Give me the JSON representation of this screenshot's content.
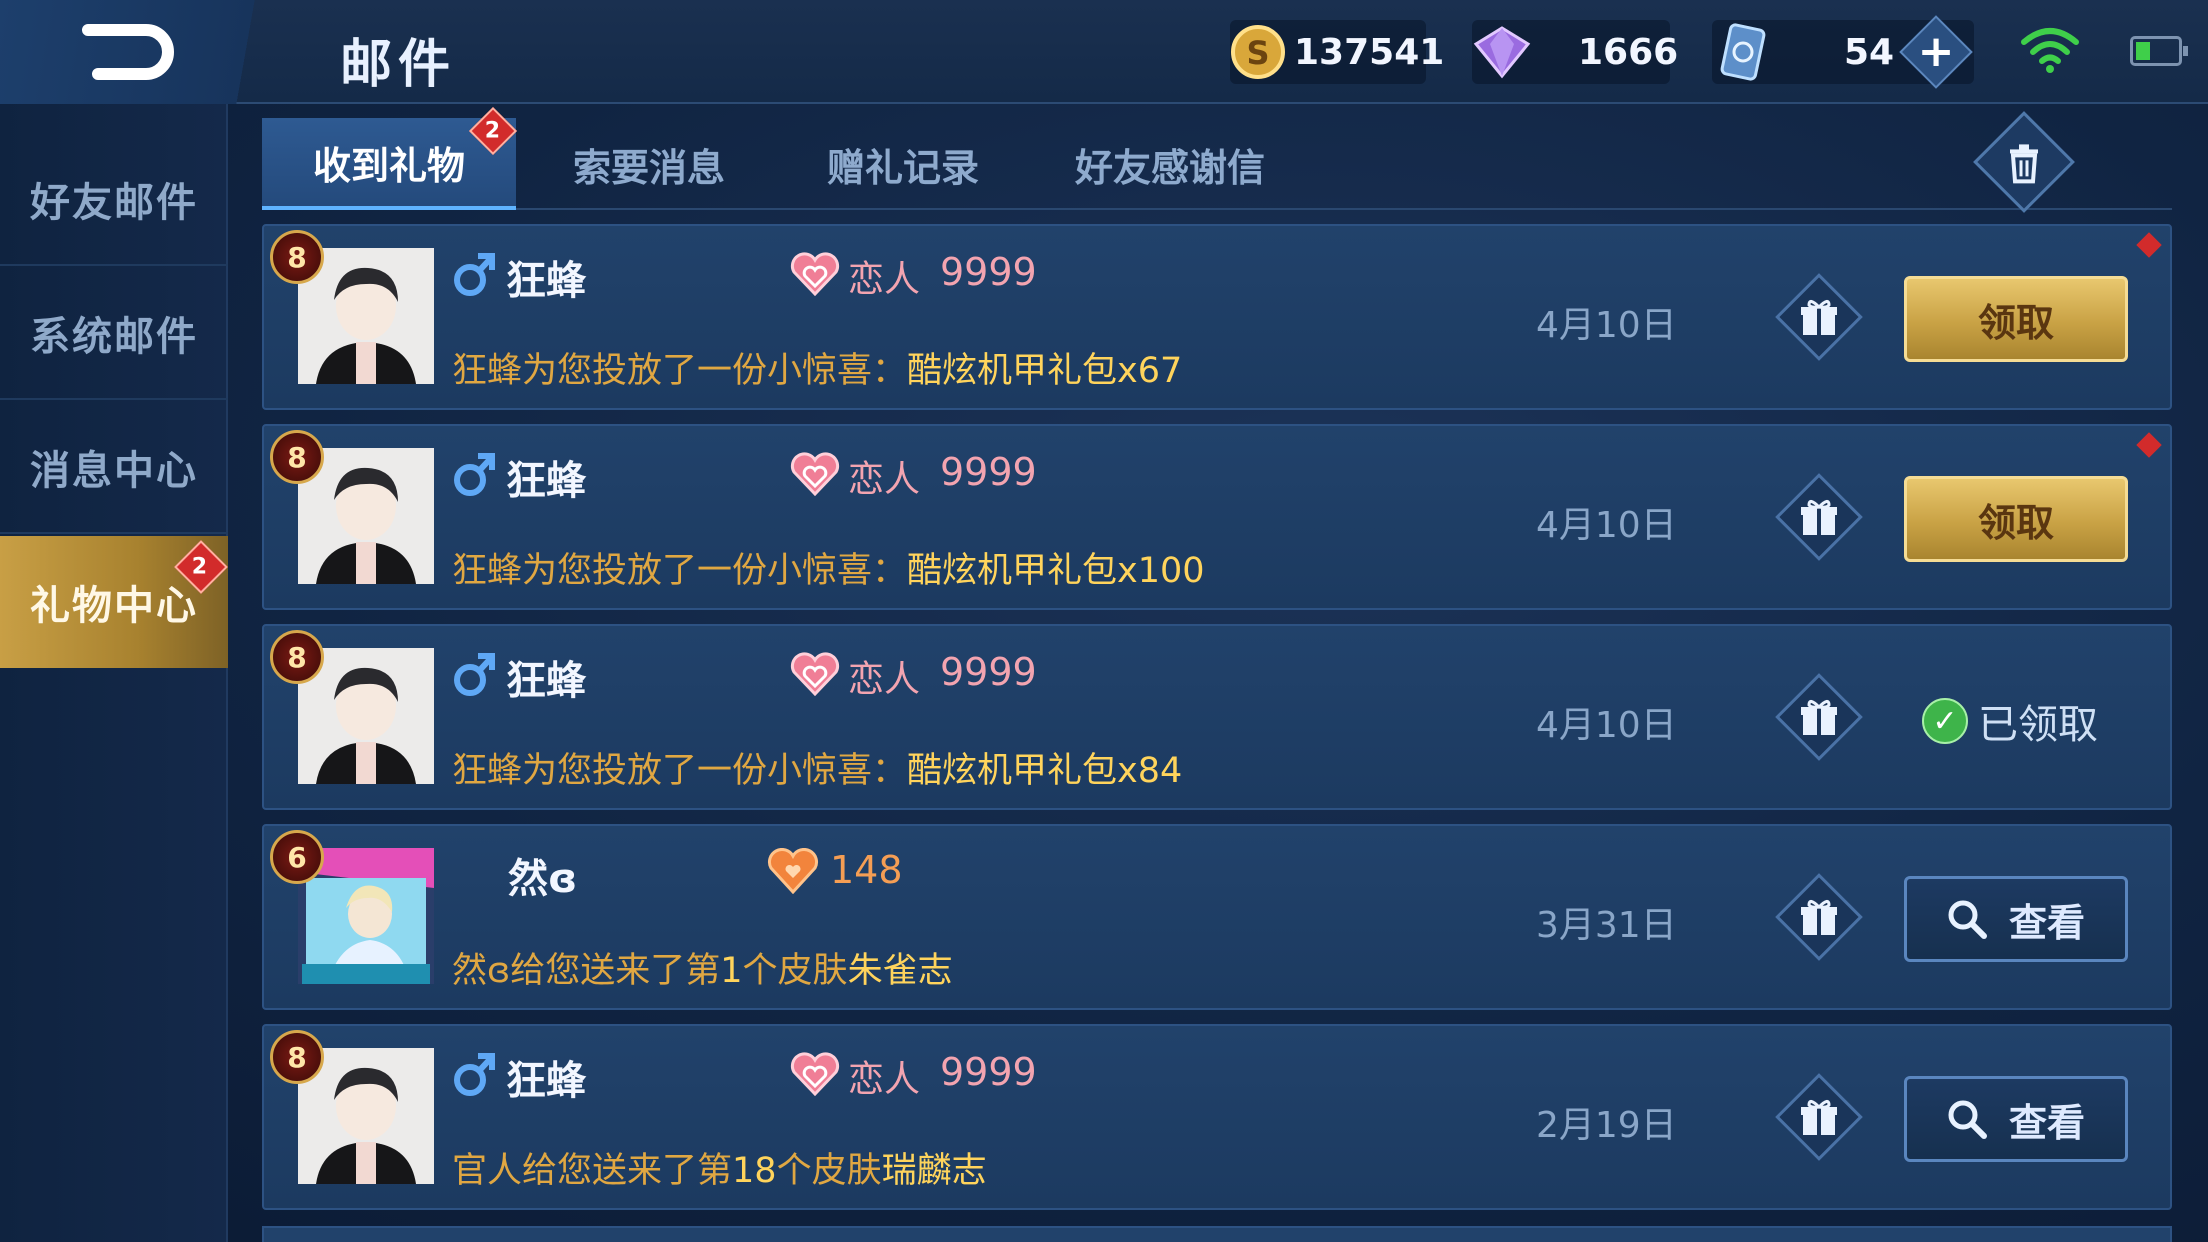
{
  "header": {
    "title": "邮件",
    "coins": "137541",
    "diamonds": "1666",
    "vouchers": "54",
    "plus_label": "+"
  },
  "sidebar": {
    "items": [
      {
        "label": "好友邮件"
      },
      {
        "label": "系统邮件"
      },
      {
        "label": "消息中心"
      },
      {
        "label": "礼物中心",
        "badge": "2"
      }
    ]
  },
  "tabs": [
    {
      "label": "收到礼物",
      "badge": "2"
    },
    {
      "label": "索要消息"
    },
    {
      "label": "赠礼记录"
    },
    {
      "label": "好友感谢信"
    }
  ],
  "mails": [
    {
      "level": "8",
      "name": "狂蜂",
      "relation": "恋人",
      "intimacy": "9999",
      "date": "4月10日",
      "sender": "狂蜂",
      "text": "为您投放了一份小惊喜：",
      "item": "酷炫机甲礼包x67",
      "action": "领取"
    },
    {
      "level": "8",
      "name": "狂蜂",
      "relation": "恋人",
      "intimacy": "9999",
      "date": "4月10日",
      "sender": "狂蜂",
      "text": "为您投放了一份小惊喜：",
      "item": "酷炫机甲礼包x100",
      "action": "领取"
    },
    {
      "level": "8",
      "name": "狂蜂",
      "relation": "恋人",
      "intimacy": "9999",
      "date": "4月10日",
      "sender": "狂蜂",
      "text": "为您投放了一份小惊喜：",
      "item": "酷炫机甲礼包x84",
      "action": "已领取"
    },
    {
      "level": "6",
      "name": "然ɞ",
      "intimacy": "148",
      "date": "3月31日",
      "sender": "然ɞ",
      "text_pre": "给您送来了第",
      "count": "1",
      "text_mid": "个皮肤",
      "item": "朱雀志",
      "action": "查看"
    },
    {
      "level": "8",
      "name": "狂蜂",
      "relation": "恋人",
      "intimacy": "9999",
      "date": "2月19日",
      "sender": "官人",
      "text_pre": "给您送来了第",
      "count": "18",
      "text_mid": "个皮肤",
      "item": "瑞麟志",
      "action": "查看"
    }
  ],
  "colors": {
    "accent_gold": "#c9a245",
    "highlight_text": "#ffd45c",
    "relation_pink": "#f3a4b0",
    "badge_red": "#d22b2b"
  }
}
